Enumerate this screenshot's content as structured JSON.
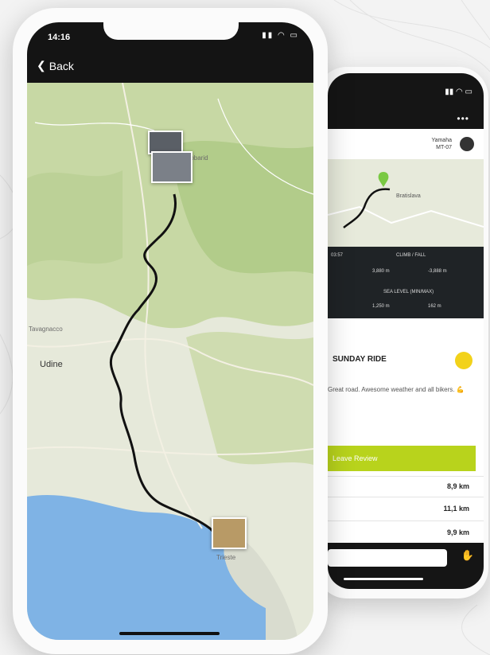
{
  "main_screen": {
    "status_time": "14:16",
    "back_label": "Back",
    "map_labels": [
      "Udine",
      "Trieste",
      "Tavagnacco",
      "Kobarid"
    ],
    "status_icons": "signal-wifi-battery"
  },
  "secondary_screen": {
    "user": {
      "name": "Yamaha",
      "sub": "MT-07"
    },
    "map_label": "Bratislava",
    "stats": {
      "climb_header": "CLIMB / FALL",
      "climb_value": "3,880 m",
      "fall_value": "-3,888 m",
      "sea_header": "SEA LEVEL (MIN/MAX)",
      "sea_min": "1,250 m",
      "sea_max": "162 m",
      "time_value": "03:57"
    },
    "ride_title": "SUNDAY RIDE",
    "description": "Great road. Awesome weather and all bikers. 💪",
    "button_label": "Leave Review",
    "distances": [
      "8,9 km",
      "11,1 km",
      "9,9 km"
    ]
  },
  "colors": {
    "accent_green": "#b8d31c",
    "water_blue": "#7fb3e5",
    "header_dark": "#141414"
  }
}
